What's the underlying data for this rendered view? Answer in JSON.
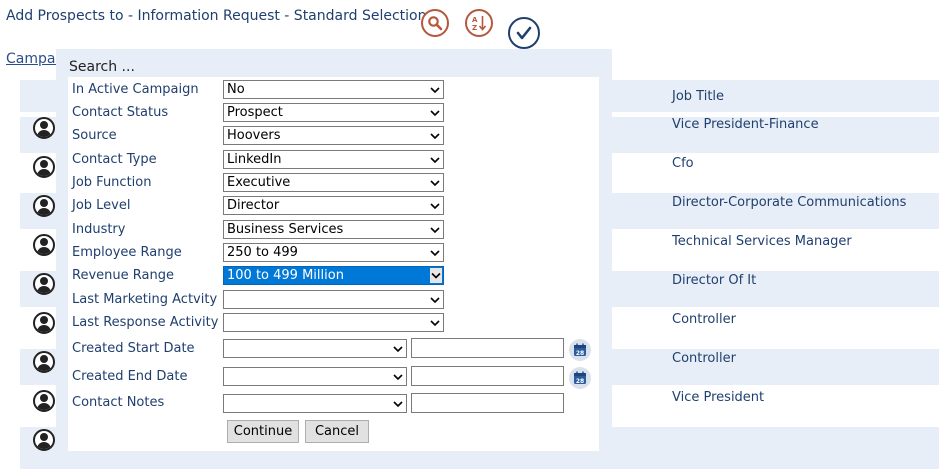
{
  "header": {
    "title": "Add Prospects to - Information Request - Standard Selection",
    "campaign_link": "Campai",
    "icons": [
      "search-icon",
      "sort-icon",
      "check-icon"
    ]
  },
  "table": {
    "job_title_header": "Job Title",
    "rows": [
      "Vice President-Finance",
      "Cfo",
      "Director-Corporate Communications",
      "Technical Services Manager",
      "Director Of It",
      "Controller",
      "Controller",
      "Vice President"
    ]
  },
  "search": {
    "title": "Search ...",
    "fields": [
      {
        "label": "In Active Campaign",
        "value": "No"
      },
      {
        "label": "Contact Status",
        "value": "Prospect"
      },
      {
        "label": "Source",
        "value": "Hoovers"
      },
      {
        "label": "Contact Type",
        "value": "LinkedIn"
      },
      {
        "label": "Job Function",
        "value": "Executive"
      },
      {
        "label": "Job Level",
        "value": "Director"
      },
      {
        "label": "Industry",
        "value": "Business Services"
      },
      {
        "label": "Employee Range",
        "value": "250 to 499"
      },
      {
        "label": "Revenue Range",
        "value": "100 to 499 Million"
      },
      {
        "label": "Last Marketing Actvity",
        "value": ""
      },
      {
        "label": "Last Response Activity",
        "value": ""
      }
    ],
    "created_start_label": "Created Start Date",
    "created_end_label": "Created End Date",
    "contact_notes_label": "Contact Notes",
    "calendar_badge": "28",
    "continue_label": "Continue",
    "cancel_label": "Cancel"
  },
  "colors": {
    "text": "#1f3f6e",
    "stripe": "#e8eef7",
    "accent_icon": "#b5583e",
    "selection": "#0078d7"
  }
}
